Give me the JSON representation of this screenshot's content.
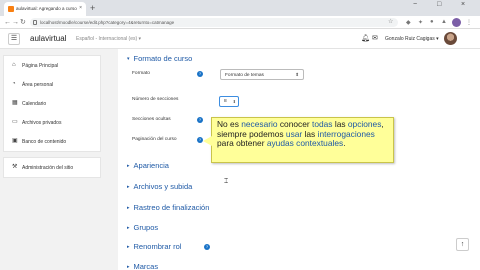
{
  "browser": {
    "tab_title": "aulavirtual: Agregando a curso",
    "tab_close": "×",
    "new_tab": "+",
    "url": "localhost/moodle/course/edit.php?category=4&returnto=catmanage",
    "controls": [
      "−",
      "□",
      "×"
    ]
  },
  "navbar": {
    "menu_icon": "☰",
    "brand": "aulavirtual",
    "language": "Español - Internacional (es) ▾",
    "user_name": "Gonzalo Ruiz Cagigas ▾"
  },
  "drawer": {
    "group1": [
      {
        "icon": "home-icon",
        "glyph": "⌂",
        "label": "Página Principal"
      },
      {
        "icon": "dashboard-icon",
        "glyph": "◔",
        "label": "Área personal"
      },
      {
        "icon": "calendar-icon",
        "glyph": "▦",
        "label": "Calendario"
      },
      {
        "icon": "file-icon",
        "glyph": "▭",
        "label": "Archivos privados"
      },
      {
        "icon": "bank-icon",
        "glyph": "▣",
        "label": "Banco de contenido"
      }
    ],
    "group2": [
      {
        "icon": "wrench-icon",
        "glyph": "⚒",
        "label": "Administración del sitio"
      }
    ]
  },
  "main": {
    "section_open": {
      "chevron": "▾",
      "title": "Formato de curso"
    },
    "fields": {
      "format_label": "Formato",
      "format_value": "Formato de temas",
      "sections_label": "Número de secciones",
      "sections_value": "8",
      "hidden_label": "Secciones ocultas",
      "pagination_label": "Paginación del curso",
      "help_glyph": "?"
    },
    "sections_collapsed": [
      {
        "chevron": "▸",
        "title": "Apariencia"
      },
      {
        "chevron": "▸",
        "title": "Archivos y subida"
      },
      {
        "chevron": "▸",
        "title": "Rastreo de finalización"
      },
      {
        "chevron": "▸",
        "title": "Grupos"
      },
      {
        "chevron": "▸",
        "title": "Renombrar rol"
      },
      {
        "chevron": "▸",
        "title": "Marcas"
      }
    ],
    "renombrar_help": "?"
  },
  "callout": {
    "parts": [
      {
        "t": "No es ",
        "k": false
      },
      {
        "t": "necesario",
        "k": true
      },
      {
        "t": " conocer ",
        "k": false
      },
      {
        "t": "todas",
        "k": true
      },
      {
        "t": " las ",
        "k": false
      },
      {
        "t": "opciones",
        "k": true
      },
      {
        "t": ", siempre podemos ",
        "k": false
      },
      {
        "t": "usar",
        "k": true
      },
      {
        "t": " las ",
        "k": false
      },
      {
        "t": "interrogaciones",
        "k": true
      },
      {
        "t": " para obtener ",
        "k": false
      },
      {
        "t": "ayudas",
        "k": true
      },
      {
        "t": " ",
        "k": false
      },
      {
        "t": "contextuales",
        "k": true
      },
      {
        "t": ".",
        "k": false
      }
    ]
  },
  "back_to_top": "↑",
  "colors": {
    "link": "#1f5aa6",
    "callout_bg": "#ffff99",
    "help": "#1a73c7",
    "brand_moodle": "#f98012"
  }
}
